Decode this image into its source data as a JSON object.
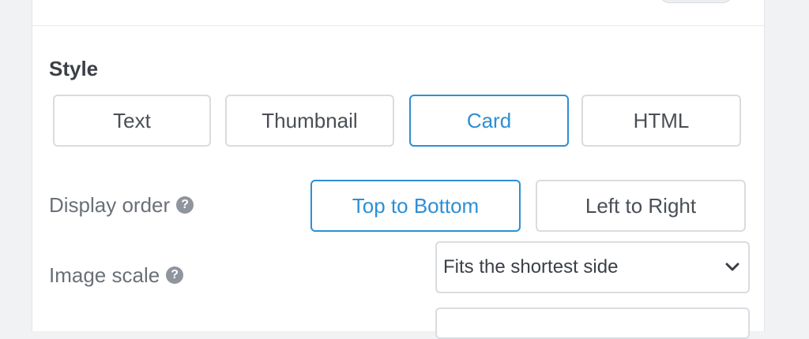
{
  "style": {
    "title": "Style",
    "options": [
      "Text",
      "Thumbnail",
      "Card",
      "HTML"
    ],
    "selected": "Card"
  },
  "display_order": {
    "label": "Display order",
    "help_icon": "question-circle-icon",
    "help_glyph": "?",
    "options": [
      "Top to Bottom",
      "Left to Right"
    ],
    "selected": "Top to Bottom"
  },
  "image_scale": {
    "label": "Image scale",
    "help_icon": "question-circle-icon",
    "help_glyph": "?",
    "value": "Fits the shortest side",
    "dropdown_icon": "chevron-down-icon"
  },
  "colors": {
    "accent": "#2d8fd5",
    "border": "#d9dcdf",
    "label": "#6b7077",
    "heading": "#3b4047"
  }
}
